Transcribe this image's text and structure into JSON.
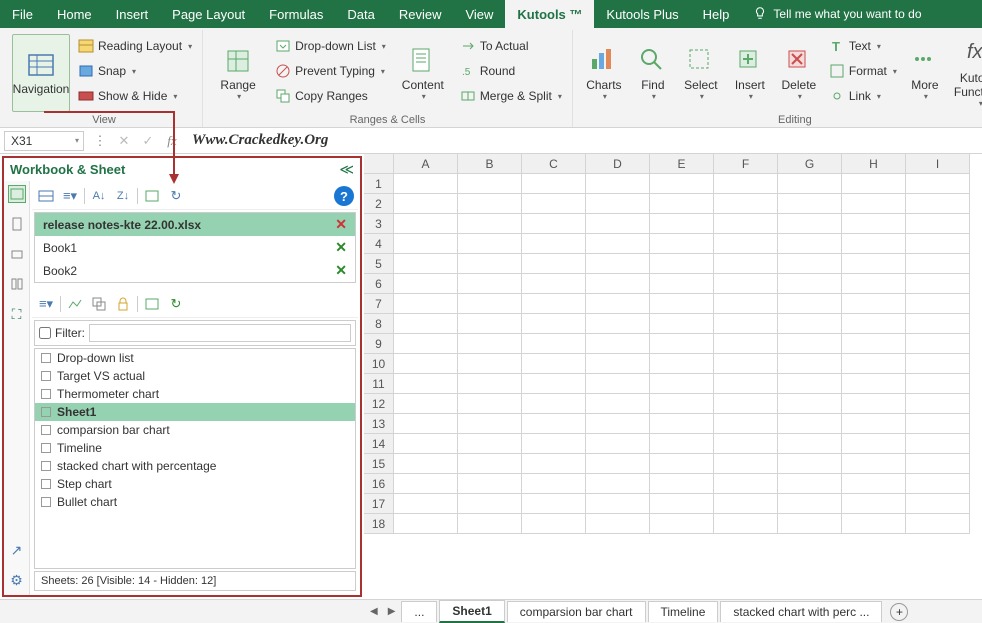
{
  "tabs": [
    "File",
    "Home",
    "Insert",
    "Page Layout",
    "Formulas",
    "Data",
    "Review",
    "View",
    "Kutools ™",
    "Kutools Plus",
    "Help"
  ],
  "active_tab": 8,
  "tell_me": "Tell me what you want to do",
  "ribbon": {
    "view_group": "View",
    "navigation": "Navigation",
    "reading_layout": "Reading Layout",
    "snap": "Snap",
    "show_hide": "Show & Hide",
    "range": "Range",
    "dropdown_list": "Drop-down List",
    "prevent_typing": "Prevent Typing",
    "copy_ranges": "Copy Ranges",
    "content": "Content",
    "to_actual": "To Actual",
    "round": "Round",
    "merge_split": "Merge & Split",
    "ranges_cells_group": "Ranges & Cells",
    "charts": "Charts",
    "find": "Find",
    "select": "Select",
    "insert": "Insert",
    "delete": "Delete",
    "text": "Text",
    "format": "Format",
    "link": "Link",
    "more": "More",
    "kutools_functions": "Kutools Functions",
    "editing_group": "Editing"
  },
  "name_box": "X31",
  "formula_text": "Www.Crackedkey.Org",
  "pane": {
    "title": "Workbook & Sheet",
    "workbooks": [
      {
        "name": "release notes-kte 22.00.xlsx",
        "active": true
      },
      {
        "name": "Book1",
        "active": false
      },
      {
        "name": "Book2",
        "active": false
      }
    ],
    "filter_label": "Filter:",
    "sheets": [
      "Drop-down list",
      "Target VS actual",
      "Thermometer chart",
      "Sheet1",
      "comparsion bar chart",
      "Timeline",
      "stacked chart with percentage",
      "Step chart",
      "Bullet chart"
    ],
    "active_sheet": 3,
    "status": "Sheets: 26  [Visible: 14 - Hidden: 12]"
  },
  "columns": [
    "A",
    "B",
    "C",
    "D",
    "E",
    "F",
    "G",
    "H",
    "I"
  ],
  "rows": [
    1,
    2,
    3,
    4,
    5,
    6,
    7,
    8,
    9,
    10,
    11,
    12,
    13,
    14,
    15,
    16,
    17,
    18
  ],
  "bottom_tabs": [
    "...",
    "Sheet1",
    "comparsion bar chart",
    "Timeline",
    "stacked chart with perc ..."
  ],
  "bottom_active": 1
}
